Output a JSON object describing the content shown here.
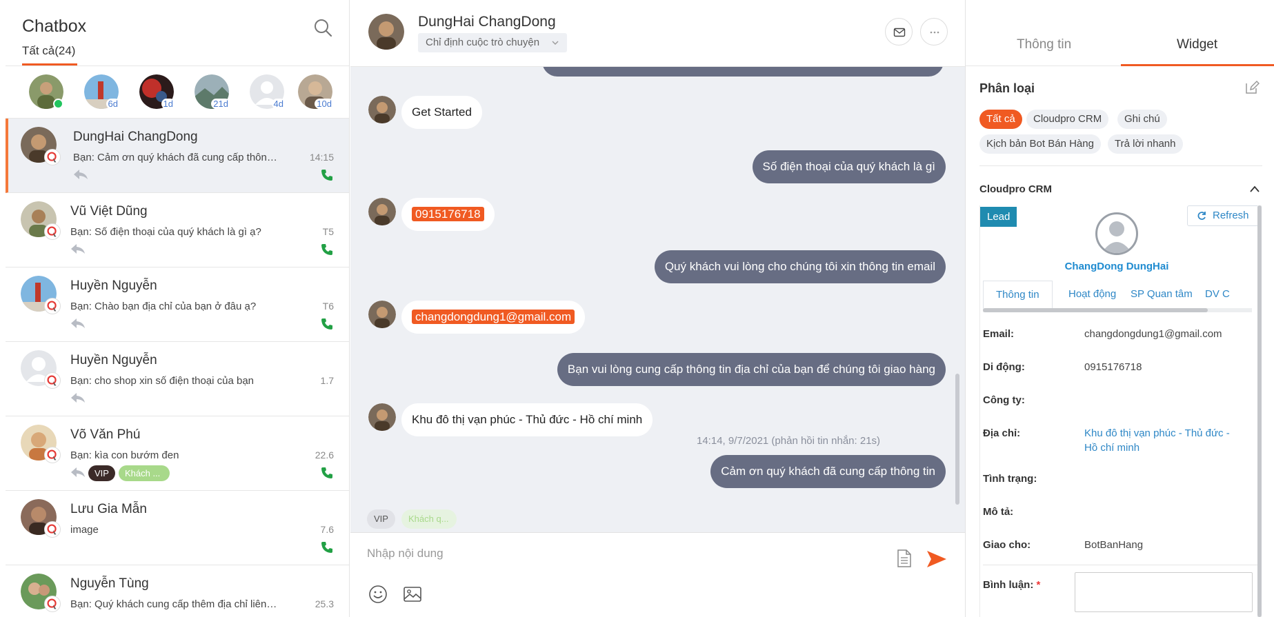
{
  "left": {
    "title": "Chatbox",
    "tab_all": "Tất cả(24)",
    "recent": [
      {
        "ago": ""
      },
      {
        "ago": "6d"
      },
      {
        "ago": "1d"
      },
      {
        "ago": "21d"
      },
      {
        "ago": "4d"
      },
      {
        "ago": "10d"
      }
    ],
    "conversations": [
      {
        "name": "DungHai ChangDong",
        "preview": "Bạn: Cảm ơn quý khách đã cung cấp thông...",
        "time": "14:15"
      },
      {
        "name": "Vũ Việt Dũng",
        "preview": "Bạn: Số điện thoại của quý khách là gì ạ?",
        "time": "T5"
      },
      {
        "name": "Huyền Nguyễn",
        "preview": "Bạn: Chào bạn địa chỉ của bạn ở đâu ạ?",
        "time": "T6"
      },
      {
        "name": "Huyền Nguyễn",
        "preview": "Bạn: cho shop xin số điện thoại của bạn",
        "time": "1.7"
      },
      {
        "name": "Võ Văn Phú",
        "preview": "Bạn: kìa con bướm đen",
        "time": "22.6",
        "tag_vip": "VIP",
        "tag_kh": "Khách ..."
      },
      {
        "name": "Lưu Gia Mẫn",
        "preview": " image",
        "time": "7.6"
      },
      {
        "name": "Nguyễn Tùng",
        "preview": "Bạn: Quý khách cung cấp thêm địa chỉ liên ...",
        "time": "25.3"
      }
    ]
  },
  "header": {
    "name": "DungHai ChangDong",
    "assign_label": "Chỉ định cuộc trò chuyện"
  },
  "messages": {
    "m1": "Get Started",
    "m2": "Số điện thoại của quý khách là gì",
    "m3": "0915176718",
    "m4": "Quý khách vui lòng cho chúng tôi xin thông tin email",
    "m5": "changdongdung1@gmail.com",
    "m6": "Bạn vui lòng cung cấp thông tin địa chỉ của bạn để chúng tôi giao hàng",
    "m7": "Khu đô thị vạn phúc - Thủ đức - Hồ chí minh",
    "m7_time": "14:14, 9/7/2021 (phản hồi tin nhắn: 21s)",
    "m8": "Cảm ơn quý khách đã cung cấp thông tin"
  },
  "mid_tags": {
    "vip": "VIP",
    "kh": "Khách q..."
  },
  "compose": {
    "placeholder": "Nhập nội dung"
  },
  "right": {
    "tab_info": "Thông tin",
    "tab_widget": "Widget",
    "section_title": "Phân loại",
    "chips": [
      "Tất cả",
      "Cloudpro CRM",
      "Ghi chú",
      "Kịch bản Bot Bán Hàng",
      "Trả lời nhanh"
    ],
    "crm": {
      "title": "Cloudpro CRM",
      "lead": "Lead",
      "refresh": "Refresh",
      "contact_name": "ChangDong DungHai",
      "tabs": [
        "Thông tin",
        "Hoạt động",
        "SP Quan tâm",
        "DV C"
      ],
      "fields": [
        {
          "label": "Email:",
          "value": "changdongdung1@gmail.com"
        },
        {
          "label": "Di động:",
          "value": "0915176718"
        },
        {
          "label": "Công ty:",
          "value": ""
        },
        {
          "label": "Địa chỉ:",
          "value": "Khu đô thị vạn phúc - Thủ đức - Hồ chí minh"
        },
        {
          "label": "Tình trạng:",
          "value": ""
        },
        {
          "label": "Mô tả:",
          "value": ""
        },
        {
          "label": "Giao cho:",
          "value": "BotBanHang"
        }
      ],
      "comment_label": "Bình luận:",
      "required_mark": "*"
    }
  },
  "colors": {
    "accent": "#f05a22",
    "bubble_out": "#676d83",
    "chat_bg": "#eef0f4",
    "lead": "#1f8bb0",
    "online": "#22c55e",
    "phone": "#22a045"
  }
}
